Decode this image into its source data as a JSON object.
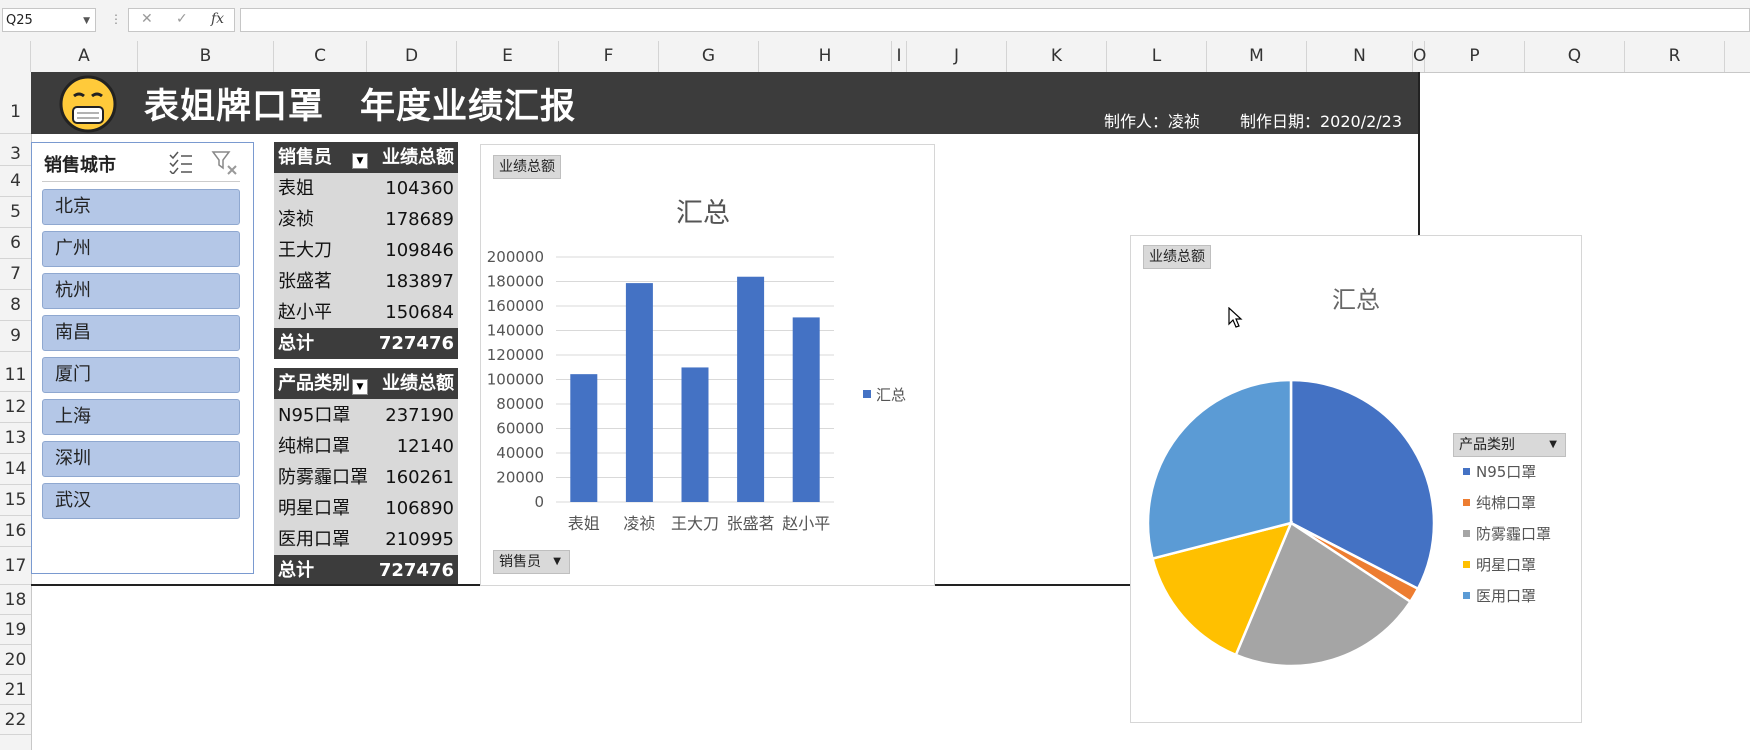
{
  "formula_bar": {
    "name_box": "Q25",
    "fx_label": "fx",
    "cancel_icon": "✕",
    "enter_icon": "✓",
    "formula": ""
  },
  "columns": [
    "A",
    "B",
    "C",
    "D",
    "E",
    "F",
    "G",
    "H",
    "I",
    "J",
    "K",
    "L",
    "M",
    "N",
    "O",
    "P",
    "Q",
    "R"
  ],
  "rows": [
    "1",
    "3",
    "4",
    "5",
    "6",
    "7",
    "8",
    "9",
    "11",
    "12",
    "13",
    "14",
    "15",
    "16",
    "17",
    "18",
    "19",
    "20",
    "21",
    "22"
  ],
  "banner": {
    "title": "表姐牌口罩　年度业绩汇报",
    "author": "制作人：凌祯",
    "date": "制作日期：2020/2/23"
  },
  "slicer": {
    "title": "销售城市",
    "items": [
      "北京",
      "广州",
      "杭州",
      "南昌",
      "厦门",
      "上海",
      "深圳",
      "武汉"
    ]
  },
  "pivot_salesperson": {
    "header_label": "销售员",
    "header_value": "业绩总额",
    "rows": [
      {
        "label": "表姐",
        "value": "104360"
      },
      {
        "label": "凌祯",
        "value": "178689"
      },
      {
        "label": "王大刀",
        "value": "109846"
      },
      {
        "label": "张盛茗",
        "value": "183897"
      },
      {
        "label": "赵小平",
        "value": "150684"
      }
    ],
    "total_label": "总计",
    "total_value": "727476"
  },
  "pivot_product": {
    "header_label": "产品类别",
    "header_value": "业绩总额",
    "rows": [
      {
        "label": "N95口罩",
        "value": "237190"
      },
      {
        "label": "纯棉口罩",
        "value": "12140"
      },
      {
        "label": "防雾霾口罩",
        "value": "160261"
      },
      {
        "label": "明星口罩",
        "value": "106890"
      },
      {
        "label": "医用口罩",
        "value": "210995"
      }
    ],
    "total_label": "总计",
    "total_value": "727476"
  },
  "bar_chart_ui": {
    "value_field_button": "业绩总额",
    "axis_field_button": "销售员"
  },
  "pie_chart_ui": {
    "value_field_button": "业绩总额",
    "legend_field_button": "产品类别"
  },
  "chart_data": [
    {
      "type": "bar",
      "title": "汇总",
      "categories": [
        "表姐",
        "凌祯",
        "王大刀",
        "张盛茗",
        "赵小平"
      ],
      "series": [
        {
          "name": "汇总",
          "values": [
            104360,
            178689,
            109846,
            183897,
            150684
          ]
        }
      ],
      "ylim": [
        0,
        200000
      ],
      "yticks": [
        0,
        20000,
        40000,
        60000,
        80000,
        100000,
        120000,
        140000,
        160000,
        180000,
        200000
      ],
      "grid": true,
      "legend": "right",
      "color": "#4472c4"
    },
    {
      "type": "pie",
      "title": "汇总",
      "labels": [
        "N95口罩",
        "纯棉口罩",
        "防雾霾口罩",
        "明星口罩",
        "医用口罩"
      ],
      "values": [
        237190,
        12140,
        160261,
        106890,
        210995
      ],
      "colors": [
        "#4472c4",
        "#ed7d31",
        "#a5a5a5",
        "#ffc000",
        "#5b9bd5"
      ],
      "legend": "right"
    }
  ]
}
